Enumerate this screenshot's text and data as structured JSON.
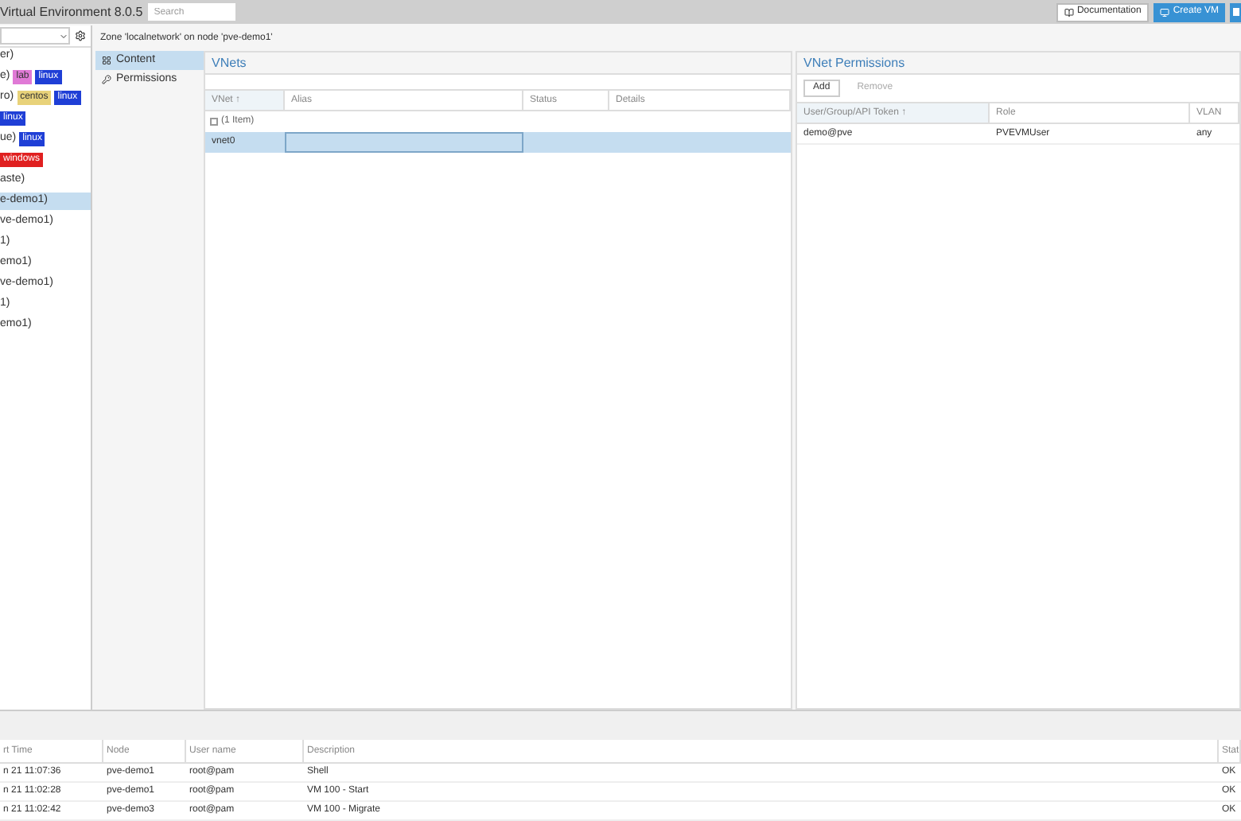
{
  "header": {
    "title": "Virtual Environment 8.0.5",
    "search": {
      "placeholder": "Search"
    },
    "buttons": [
      {
        "label": "Documentation",
        "kind": "plain"
      },
      {
        "label": "Create VM",
        "kind": "primary"
      },
      {
        "kind": "primary-edge"
      }
    ]
  },
  "tree": {
    "items": [
      {
        "label": "er)",
        "selected": false
      },
      {
        "label": "e)",
        "tags": [
          {
            "text": "lab",
            "color": "#e07ad6"
          },
          {
            "text": "linux",
            "color": "#1f3fd6"
          }
        ],
        "selected": false
      },
      {
        "label": "ro)",
        "tags": [
          {
            "text": "centos",
            "color": "#e8d27a"
          },
          {
            "text": "linux",
            "color": "#1f3fd6"
          }
        ],
        "selected": false
      },
      {
        "tags": [
          {
            "text": "linux",
            "color": "#1f3fd6"
          }
        ],
        "selected": false
      },
      {
        "label": "ue)",
        "tags": [
          {
            "text": "linux",
            "color": "#1f3fd6"
          }
        ],
        "selected": false
      },
      {
        "tags": [
          {
            "text": "windows",
            "color": "#e02020"
          }
        ],
        "selected": false
      },
      {
        "label": "aste)",
        "selected": false
      },
      {
        "label": "e-demo1)",
        "selected": true
      },
      {
        "label": "ve-demo1)",
        "selected": false
      },
      {
        "label": "1)",
        "selected": false
      },
      {
        "label": "emo1)",
        "selected": false
      },
      {
        "label": "ve-demo1)",
        "selected": false
      },
      {
        "label": "1)",
        "selected": false
      },
      {
        "label": "emo1)",
        "selected": false
      }
    ]
  },
  "breadcrumb": "Zone 'localnetwork' on node 'pve-demo1'",
  "nav": [
    {
      "label": "Content",
      "selected": true,
      "kind": "grid"
    },
    {
      "label": "Permissions",
      "selected": false,
      "kind": "key"
    }
  ],
  "vnets": {
    "title": "VNets",
    "columns": [
      "VNet ↑",
      "Alias",
      "Status",
      "Details"
    ],
    "group": "(1 Item)",
    "rows": [
      {
        "cells": [
          "vnet0"
        ],
        "selected": true
      }
    ]
  },
  "permissions": {
    "title": "VNet Permissions",
    "buttons": [
      {
        "label": "Add",
        "disabled": false
      },
      {
        "label": "Remove",
        "disabled": true
      }
    ],
    "columns": [
      "User/Group/API Token ↑",
      "Role",
      "VLAN"
    ],
    "rows": [
      {
        "cells": [
          "demo@pve",
          "PVEVMUser",
          "any"
        ]
      }
    ]
  },
  "log": {
    "columns": [
      "rt Time",
      "Node",
      "User name",
      "Description",
      "Stat"
    ],
    "rows": [
      {
        "cells": [
          "n 21 11:07:36",
          "pve-demo1",
          "root@pam",
          "Shell",
          "OK"
        ]
      },
      {
        "cells": [
          "n 21 11:02:28",
          "pve-demo1",
          "root@pam",
          "VM 100 - Start",
          "OK"
        ]
      },
      {
        "cells": [
          "n 21 11:02:42",
          "pve-demo3",
          "root@pam",
          "VM 100 - Migrate",
          "OK"
        ]
      }
    ]
  }
}
